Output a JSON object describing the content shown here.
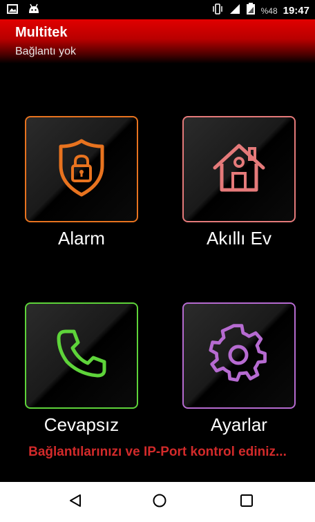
{
  "status_bar": {
    "icons_left": [
      "image-icon",
      "android-icon"
    ],
    "icons_right": [
      "vibrate-icon",
      "signal-icon",
      "battery-icon"
    ],
    "battery": "%48",
    "time": "19:47"
  },
  "app_bar": {
    "title": "Multitek",
    "subtitle": "Bağlantı yok",
    "color": "#e10000"
  },
  "tiles": [
    {
      "label": "Alarm",
      "icon": "shield-lock-icon",
      "color": "#e8731f"
    },
    {
      "label": "Akıllı Ev",
      "icon": "house-icon",
      "color": "#e57a7a"
    },
    {
      "label": "Cevapsız",
      "icon": "phone-icon",
      "color": "#5ed43a"
    },
    {
      "label": "Ayarlar",
      "icon": "gear-icon",
      "color": "#b66bd1"
    }
  ],
  "warning": {
    "text": "Bağlantılarınızı ve IP-Port kontrol ediniz...",
    "color": "#d22a2a"
  },
  "nav_bar": {
    "buttons": [
      "back-icon",
      "home-icon",
      "recent-apps-icon"
    ]
  }
}
